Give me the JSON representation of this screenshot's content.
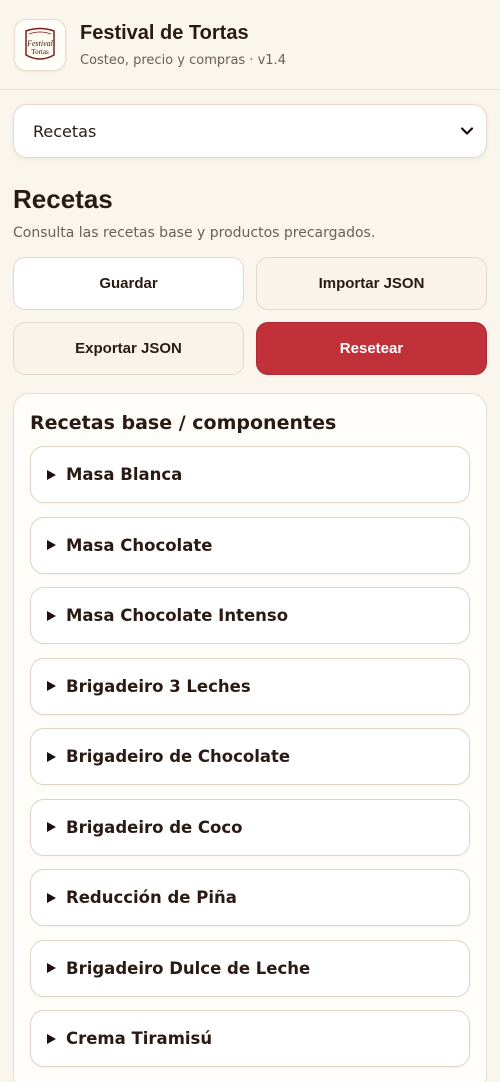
{
  "header": {
    "title": "Festival de Tortas",
    "subtitle": "Costeo, precio y compras · v1.4",
    "logo_text_top": "Festival",
    "logo_text_bottom": "Tortas"
  },
  "view_select": {
    "selected": "Recetas",
    "icon": "chevron-down-icon"
  },
  "page": {
    "title": "Recetas",
    "subtitle": "Consulta las recetas base y productos precargados."
  },
  "actions": {
    "save": "Guardar",
    "import": "Importar JSON",
    "export": "Exportar JSON",
    "reset": "Resetear"
  },
  "recipes_card": {
    "title": "Recetas base / componentes",
    "items": [
      "Masa Blanca",
      "Masa Chocolate",
      "Masa Chocolate Intenso",
      "Brigadeiro 3 Leches",
      "Brigadeiro de Chocolate",
      "Brigadeiro de Coco",
      "Reducción de Piña",
      "Brigadeiro Dulce de Leche",
      "Crema Tiramisú"
    ]
  },
  "colors": {
    "background": "#faf6ee",
    "danger": "#c0313a",
    "text": "#2a1a14"
  }
}
